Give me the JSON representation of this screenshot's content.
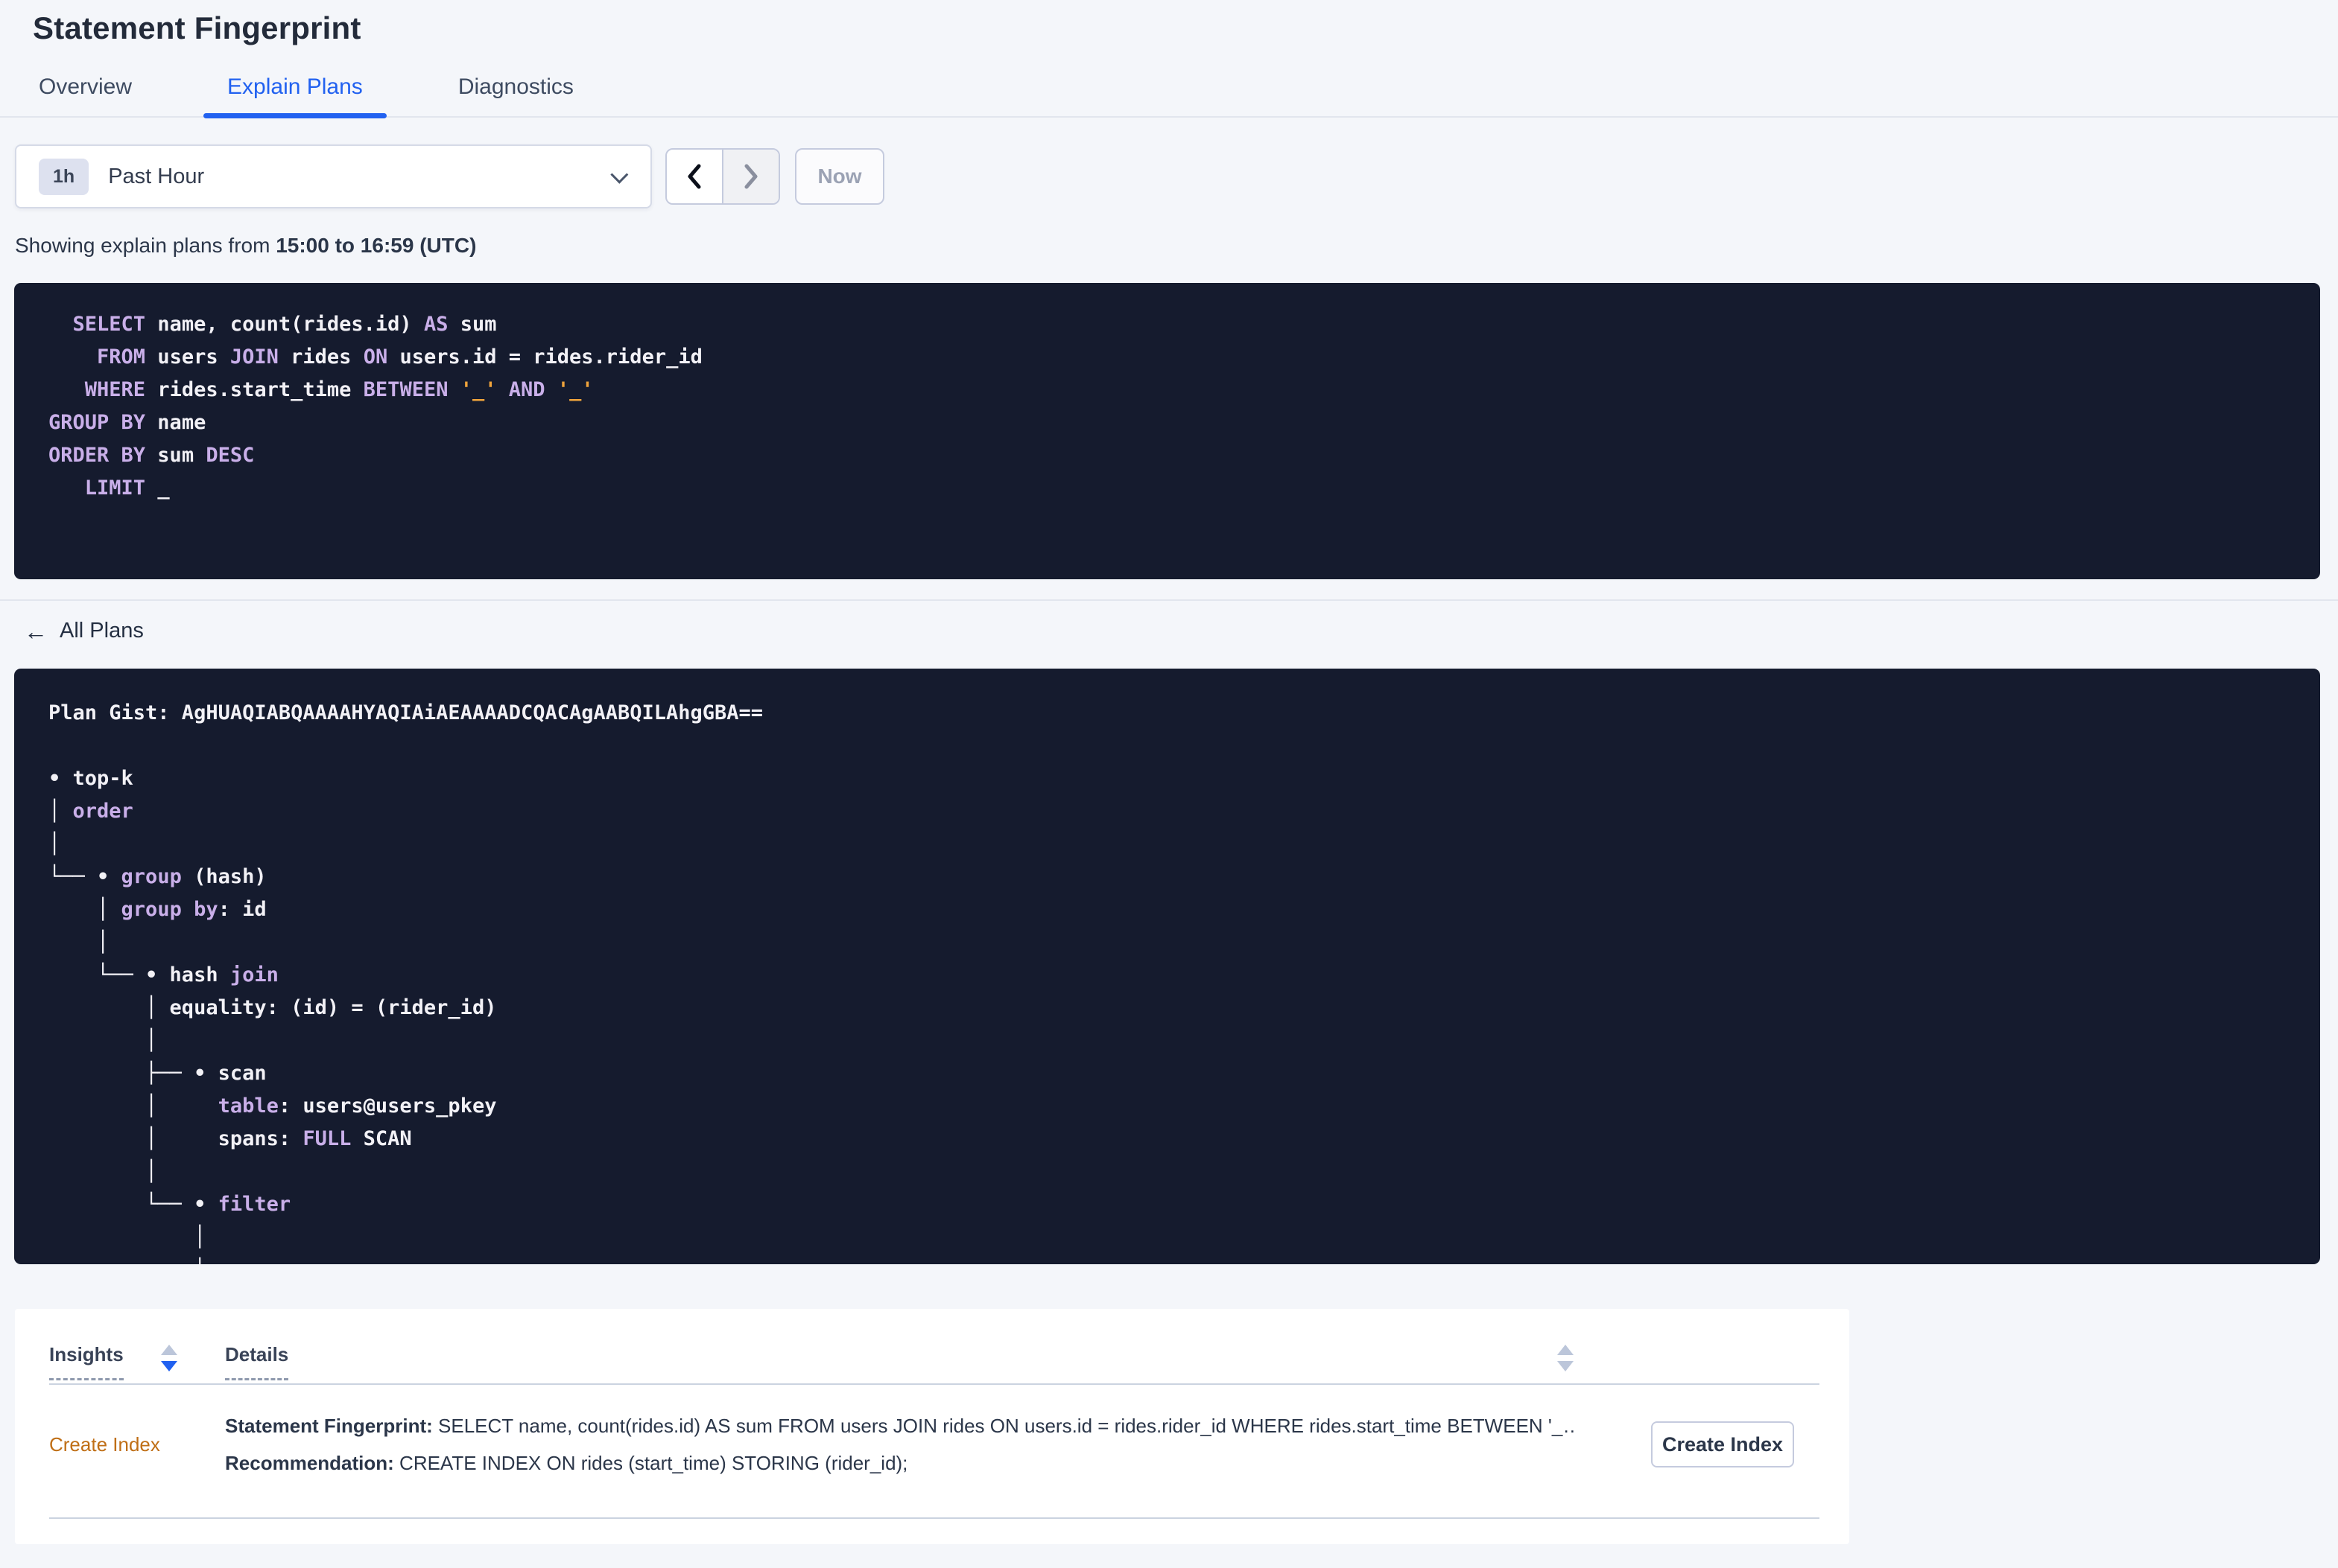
{
  "colors": {
    "accent_blue": "#2161F0",
    "panel_background": "#151B2E",
    "sql_keyword": "#C9AFE9",
    "sql_literal": "#F0A43C",
    "insight_link_orange": "#BF6E15"
  },
  "header": {
    "title": "Statement Fingerprint"
  },
  "tabs": {
    "active_index": 1,
    "items": [
      {
        "label": "Overview"
      },
      {
        "label": "Explain Plans"
      },
      {
        "label": "Diagnostics"
      }
    ]
  },
  "time_controls": {
    "duration_badge": "1h",
    "range_label": "Past Hour",
    "now_label": "Now"
  },
  "showing": {
    "prefix": "Showing explain plans from ",
    "bold_range": "15:00 to 16:59 (UTC)"
  },
  "sql_fingerprint": {
    "lines": [
      [
        {
          "t": "  "
        },
        {
          "t": "SELECT",
          "c": "kw"
        },
        {
          "t": " name, count(rides.id) "
        },
        {
          "t": "AS",
          "c": "kw"
        },
        {
          "t": " sum"
        }
      ],
      [
        {
          "t": "    "
        },
        {
          "t": "FROM",
          "c": "kw"
        },
        {
          "t": " users "
        },
        {
          "t": "JOIN",
          "c": "kw"
        },
        {
          "t": " rides "
        },
        {
          "t": "ON",
          "c": "kw"
        },
        {
          "t": " users.id = rides.rider_id"
        }
      ],
      [
        {
          "t": "   "
        },
        {
          "t": "WHERE",
          "c": "kw"
        },
        {
          "t": " rides.start_time "
        },
        {
          "t": "BETWEEN",
          "c": "kw"
        },
        {
          "t": " "
        },
        {
          "t": "'_'",
          "c": "lit"
        },
        {
          "t": " "
        },
        {
          "t": "AND",
          "c": "kw"
        },
        {
          "t": " "
        },
        {
          "t": "'_'",
          "c": "lit"
        }
      ],
      [
        {
          "t": "GROUP BY",
          "c": "kw"
        },
        {
          "t": " name"
        }
      ],
      [
        {
          "t": "ORDER BY",
          "c": "kw"
        },
        {
          "t": " sum "
        },
        {
          "t": "DESC",
          "c": "kw"
        }
      ],
      [
        {
          "t": "   "
        },
        {
          "t": "LIMIT",
          "c": "kw"
        },
        {
          "t": " _"
        }
      ]
    ]
  },
  "nav": {
    "all_plans_label": "All Plans",
    "back_arrow": "←"
  },
  "plan": {
    "lines": [
      [
        {
          "t": "Plan Gist: AgHUAQIABQAAAAHYAQIAiAEAAAADCQACAgAABQILAhgGBA=="
        }
      ],
      [
        {
          "t": ""
        }
      ],
      [
        {
          "t": "• top-k"
        }
      ],
      [
        {
          "t": "│ "
        },
        {
          "t": "order",
          "c": "kw"
        }
      ],
      [
        {
          "t": "│"
        }
      ],
      [
        {
          "t": "└── • "
        },
        {
          "t": "group",
          "c": "kw"
        },
        {
          "t": " (hash)"
        }
      ],
      [
        {
          "t": "    │ "
        },
        {
          "t": "group by",
          "c": "kw"
        },
        {
          "t": ": id"
        }
      ],
      [
        {
          "t": "    │"
        }
      ],
      [
        {
          "t": "    └── • hash "
        },
        {
          "t": "join",
          "c": "kw"
        }
      ],
      [
        {
          "t": "        │ equality: (id) = (rider_id)"
        }
      ],
      [
        {
          "t": "        │"
        }
      ],
      [
        {
          "t": "        ├── • scan"
        }
      ],
      [
        {
          "t": "        │     "
        },
        {
          "t": "table",
          "c": "kw"
        },
        {
          "t": ": users@users_pkey"
        }
      ],
      [
        {
          "t": "        │     spans: "
        },
        {
          "t": "FULL",
          "c": "kw"
        },
        {
          "t": " SCAN"
        }
      ],
      [
        {
          "t": "        │"
        }
      ],
      [
        {
          "t": "        └── • "
        },
        {
          "t": "filter",
          "c": "kw"
        }
      ],
      [
        {
          "t": "            │"
        }
      ],
      [
        {
          "t": "            │"
        }
      ]
    ]
  },
  "insights_table": {
    "insights_header": "Insights",
    "details_header": "Details",
    "row": {
      "insight_type": "Create Index",
      "fingerprint_label": "Statement Fingerprint:",
      "fingerprint_text": " SELECT name, count(rides.id) AS sum FROM users JOIN rides ON users.id = rides.rider_id WHERE rides.start_time BETWEEN '_…",
      "recommendation_label": "Recommendation:",
      "recommendation_text": " CREATE INDEX ON rides (start_time) STORING (rider_id);",
      "action_label": "Create Index"
    }
  }
}
